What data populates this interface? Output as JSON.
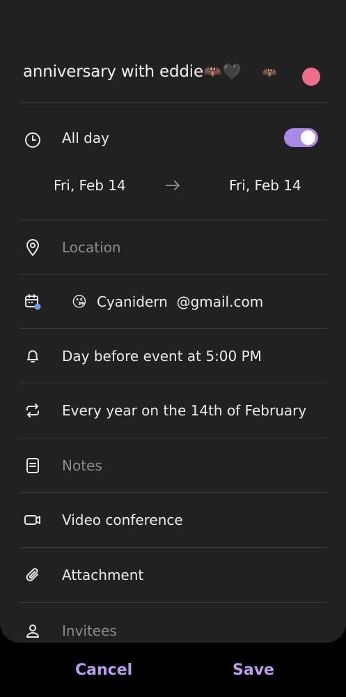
{
  "event": {
    "title": "anniversary with eddie",
    "title_emoji": "🦇🖤",
    "bat_sticker": "🦇",
    "color_hex": "#ef6e8e"
  },
  "all_day": {
    "label": "All day",
    "enabled": true,
    "start_date": "Fri, Feb 14",
    "end_date": "Fri, Feb 14"
  },
  "location": {
    "placeholder": "Location"
  },
  "account": {
    "emoji": "😘",
    "name": "Cyanidern",
    "domain": "@gmail.com"
  },
  "reminder": {
    "label": "Day before event at 5:00 PM"
  },
  "repeat": {
    "label": "Every year on the 14th of February"
  },
  "notes": {
    "placeholder": "Notes"
  },
  "video": {
    "label": "Video conference"
  },
  "attachment": {
    "label": "Attachment"
  },
  "invitees": {
    "placeholder": "Invitees"
  },
  "footer": {
    "cancel": "Cancel",
    "save": "Save"
  },
  "colors": {
    "accent": "#a88ae6",
    "footer_text": "#b9a0ef",
    "background": "#212121"
  },
  "icons": [
    "clock-icon",
    "arrow-right-icon",
    "location-pin-icon",
    "calendar-account-icon",
    "bell-icon",
    "repeat-icon",
    "notes-icon",
    "video-icon",
    "paperclip-icon",
    "person-icon"
  ]
}
